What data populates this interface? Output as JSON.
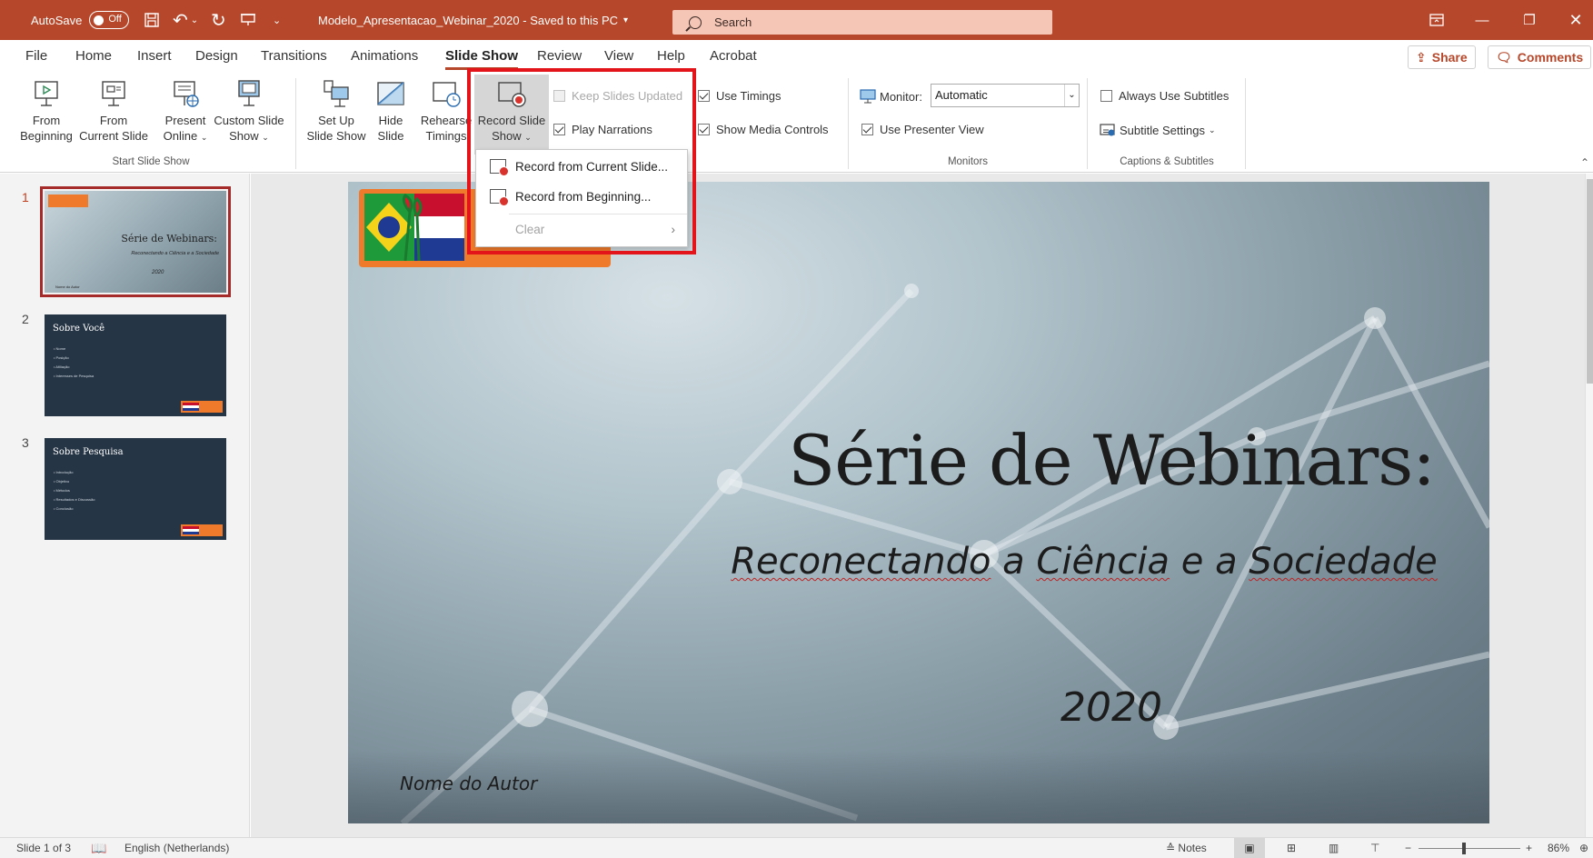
{
  "titlebar": {
    "autosave_label": "AutoSave",
    "autosave_state": "Off",
    "document_title": "Modelo_Apresentacao_Webinar_2020",
    "save_status": "Saved to this PC",
    "search_placeholder": "Search",
    "accent_color": "#b7472a"
  },
  "tabs": [
    "File",
    "Home",
    "Insert",
    "Design",
    "Transitions",
    "Animations",
    "Slide Show",
    "Review",
    "View",
    "Help",
    "Acrobat"
  ],
  "active_tab": "Slide Show",
  "share_label": "Share",
  "comments_label": "Comments",
  "ribbon": {
    "from_beginning": [
      "From",
      "Beginning"
    ],
    "from_current": [
      "From",
      "Current Slide"
    ],
    "present_online": [
      "Present",
      "Online"
    ],
    "custom_show": [
      "Custom Slide",
      "Show"
    ],
    "group_start": "Start Slide Show",
    "setup_show": [
      "Set Up",
      "Slide Show"
    ],
    "hide_slide": [
      "Hide",
      "Slide"
    ],
    "rehearse": [
      "Rehearse",
      "Timings"
    ],
    "record_show": [
      "Record Slide",
      "Show"
    ],
    "keep_updated": "Keep Slides Updated",
    "play_narrations": "Play Narrations",
    "use_timings": "Use Timings",
    "show_media_controls": "Show Media Controls",
    "monitor_label": "Monitor:",
    "monitor_value": "Automatic",
    "use_presenter_view": "Use Presenter View",
    "group_monitors": "Monitors",
    "always_subtitles": "Always Use Subtitles",
    "subtitle_settings": "Subtitle Settings",
    "group_captions": "Captions & Subtitles"
  },
  "dropdown": {
    "items": [
      "Record from Current Slide...",
      "Record from Beginning...",
      "Clear"
    ]
  },
  "thumbnails": [
    {
      "num": "1",
      "title": "Série de Webinars:",
      "subtitle": "Reconectando a Ciência e a Sociedade",
      "year": "2020",
      "author": "Nome do Autor"
    },
    {
      "num": "2",
      "title": "Sobre Você",
      "bullets": [
        "Nome",
        "Posição",
        "Afiliação",
        "Interesses de Pesquisa"
      ]
    },
    {
      "num": "3",
      "title": "Sobre Pesquisa",
      "bullets": [
        "Introdução",
        "Objetivo",
        "Métodos",
        "Resultados e Discussão",
        "Conclusão"
      ]
    }
  ],
  "slide": {
    "title": "Série de Webinars:",
    "subtitle_parts": [
      "Reconectando",
      " a ",
      "Ciência",
      " e a ",
      "Sociedade"
    ],
    "year": "2020",
    "author": "Nome do Autor"
  },
  "status": {
    "slide_info": "Slide 1 of 3",
    "language": "English (Netherlands)",
    "notes": "Notes",
    "zoom": "86%"
  }
}
